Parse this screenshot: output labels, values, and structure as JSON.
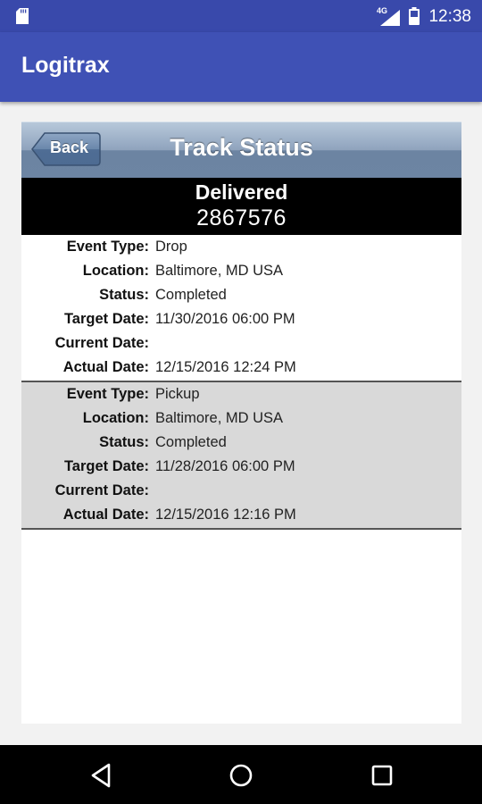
{
  "status_bar": {
    "network_label": "4G",
    "time": "12:38"
  },
  "app_bar": {
    "title": "Logitrax"
  },
  "header": {
    "back_label": "Back",
    "title": "Track Status"
  },
  "shipment": {
    "status": "Delivered",
    "tracking_number": "2867576"
  },
  "labels": {
    "event_type": "Event Type:",
    "location": "Location:",
    "status": "Status:",
    "target_date": "Target Date:",
    "current_date": "Current Date:",
    "actual_date": "Actual Date:"
  },
  "events": [
    {
      "event_type": "Drop",
      "location": "Baltimore, MD USA",
      "status": "Completed",
      "target_date": "11/30/2016 06:00 PM",
      "current_date": "",
      "actual_date": "12/15/2016 12:24 PM"
    },
    {
      "event_type": "Pickup",
      "location": "Baltimore, MD USA",
      "status": "Completed",
      "target_date": "11/28/2016 06:00 PM",
      "current_date": "",
      "actual_date": "12/15/2016 12:16 PM"
    }
  ],
  "colors": {
    "status_bar": "#3949ab",
    "app_bar": "#3f51b5",
    "header_gradient_top": "#b7c8da",
    "header_gradient_bottom": "#6c84a2",
    "alt_row": "#d9d9d9"
  }
}
